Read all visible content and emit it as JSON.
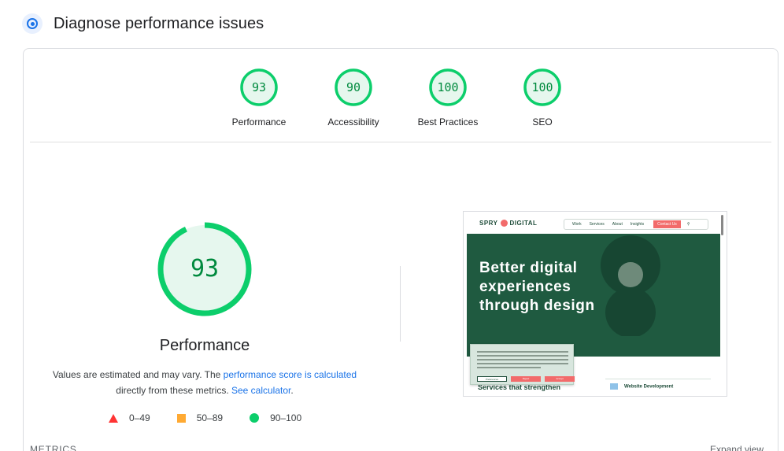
{
  "header": {
    "title": "Diagnose performance issues",
    "icon": "lighthouse-icon",
    "icon_color": "#1a73e8"
  },
  "colors": {
    "pass": "#0cce6b",
    "pass_text": "#008a3e",
    "average": "#ffaa33",
    "fail": "#ff3333",
    "link": "#1a73e8"
  },
  "categories": [
    {
      "label": "Performance",
      "score": "93"
    },
    {
      "label": "Accessibility",
      "score": "90"
    },
    {
      "label": "Best Practices",
      "score": "100"
    },
    {
      "label": "SEO",
      "score": "100"
    }
  ],
  "main": {
    "score": "93",
    "title": "Performance",
    "note_text_1": "Values are estimated and may vary. The ",
    "note_link_1": "performance score is calculated",
    "note_text_2": "directly from these metrics. ",
    "note_link_2": "See calculator",
    "note_text_3": "."
  },
  "legend": [
    {
      "shape": "triangle",
      "range": "0–49"
    },
    {
      "shape": "square",
      "range": "50–89"
    },
    {
      "shape": "circle",
      "range": "90–100"
    }
  ],
  "footer": {
    "metrics_label": "METRICS",
    "expand_view": "Expand view"
  },
  "screenshot": {
    "logo_left": "SPRY",
    "logo_right": "DIGITAL",
    "nav": [
      "Work",
      "Services",
      "About",
      "Insights"
    ],
    "contact": "Contact Us",
    "hero_line_1": "Better digital",
    "hero_line_2": "experiences",
    "hero_line_3": "through design",
    "below_left": "Services that strengthen",
    "below_right": "Website Development",
    "cookie_pref": "Preferences",
    "cookie_reject": "Reject",
    "cookie_accept": "Accept",
    "hero_color": "#1f5a40"
  }
}
